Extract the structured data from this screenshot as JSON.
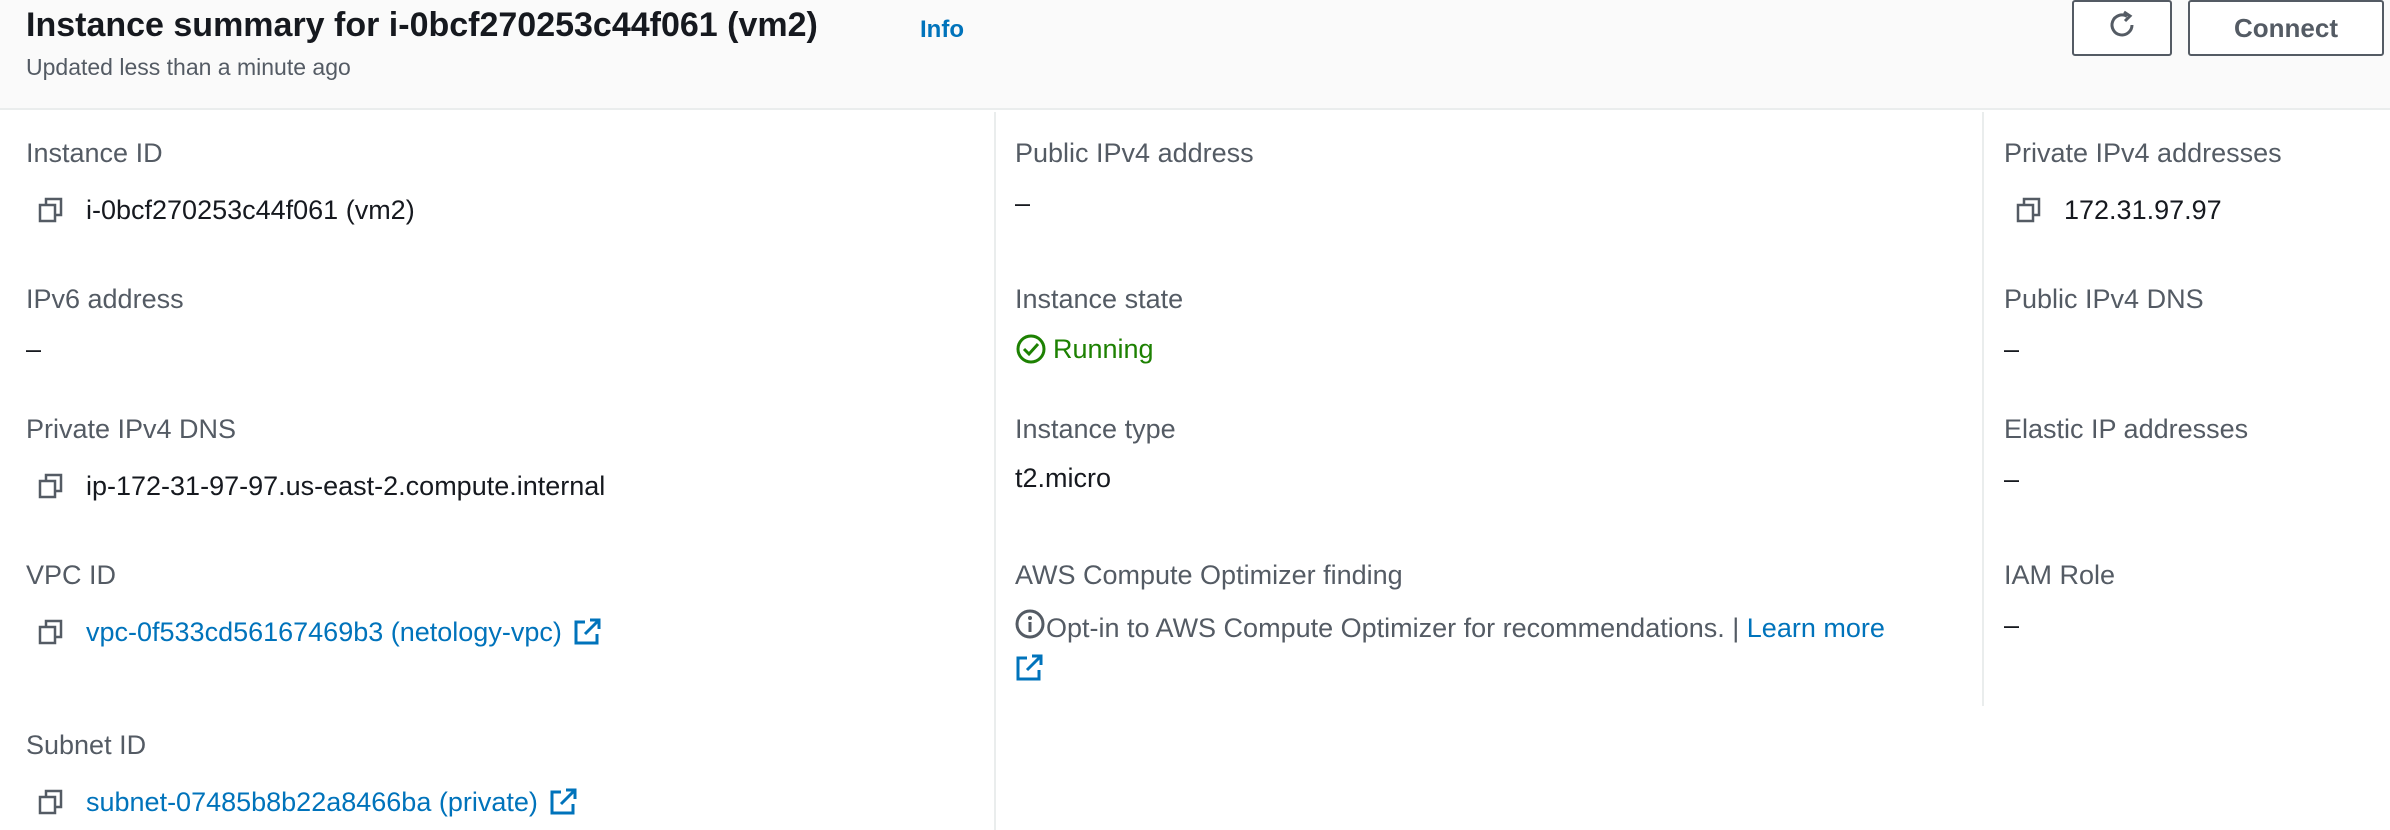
{
  "header": {
    "title": "Instance summary for i-0bcf270253c44f061 (vm2)",
    "info_label": "Info",
    "subtitle": "Updated less than a minute ago",
    "refresh_icon": "refresh-icon",
    "connect_label": "Connect"
  },
  "fields": {
    "instance_id": {
      "label": "Instance ID",
      "value": "i-0bcf270253c44f061 (vm2)"
    },
    "ipv6": {
      "label": "IPv6 address",
      "value": "–"
    },
    "private_dns": {
      "label": "Private IPv4 DNS",
      "value": "ip-172-31-97-97.us-east-2.compute.internal"
    },
    "vpc_id": {
      "label": "VPC ID",
      "value": "vpc-0f533cd56167469b3 (netology-vpc)"
    },
    "subnet_id": {
      "label": "Subnet ID",
      "value": "subnet-07485b8b22a8466ba (private)"
    },
    "public_ipv4": {
      "label": "Public IPv4 address",
      "value": "–"
    },
    "instance_state": {
      "label": "Instance state",
      "value": "Running"
    },
    "instance_type": {
      "label": "Instance type",
      "value": "t2.micro"
    },
    "optimizer": {
      "label": "AWS Compute Optimizer finding",
      "text": "Opt-in to AWS Compute Optimizer for recommendations. |",
      "link": "Learn more"
    },
    "private_ipv4": {
      "label": "Private IPv4 addresses",
      "value": "172.31.97.97"
    },
    "public_dns": {
      "label": "Public IPv4 DNS",
      "value": "–"
    },
    "elastic_ip": {
      "label": "Elastic IP addresses",
      "value": "–"
    },
    "iam_role": {
      "label": "IAM Role",
      "value": "–"
    }
  },
  "colors": {
    "link": "#0073bb",
    "running": "#1d8102",
    "label": "#545b64",
    "text": "#16191f"
  }
}
